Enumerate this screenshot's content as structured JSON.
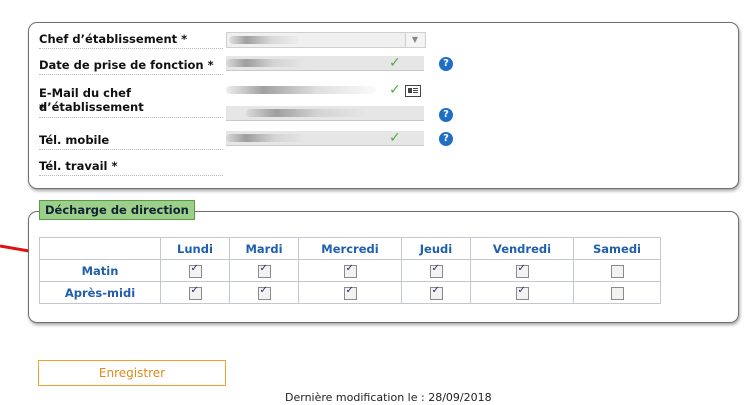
{
  "chef": {
    "fields": [
      {
        "label": "Chef d’établissement *"
      },
      {
        "label": "Date de prise de fonction *"
      },
      {
        "label": "E-Mail du chef d’établissement",
        "label_line2": "*"
      },
      {
        "label": "Tél. mobile"
      },
      {
        "label": "Tél. travail *"
      }
    ],
    "help_glyph": "?",
    "check_glyph": "✓",
    "dropdown_glyph": "▼"
  },
  "decharge": {
    "title": "Décharge de direction",
    "days": [
      "Lundi",
      "Mardi",
      "Mercredi",
      "Jeudi",
      "Vendredi",
      "Samedi"
    ],
    "rows": [
      {
        "label": "Matin",
        "checked": [
          true,
          true,
          true,
          true,
          true,
          false
        ]
      },
      {
        "label": "Après-midi",
        "checked": [
          true,
          true,
          true,
          true,
          true,
          false
        ]
      }
    ]
  },
  "actions": {
    "save_label": "Enregistrer"
  },
  "footer": {
    "last_modified": "Dernière modification le : 28/09/2018"
  },
  "colors": {
    "accent_blue": "#1f5fae",
    "check_green": "#4fae3a",
    "tag_green": "#9ccf8a",
    "save_orange": "#e08a1a",
    "arrow_red": "#e01010"
  }
}
